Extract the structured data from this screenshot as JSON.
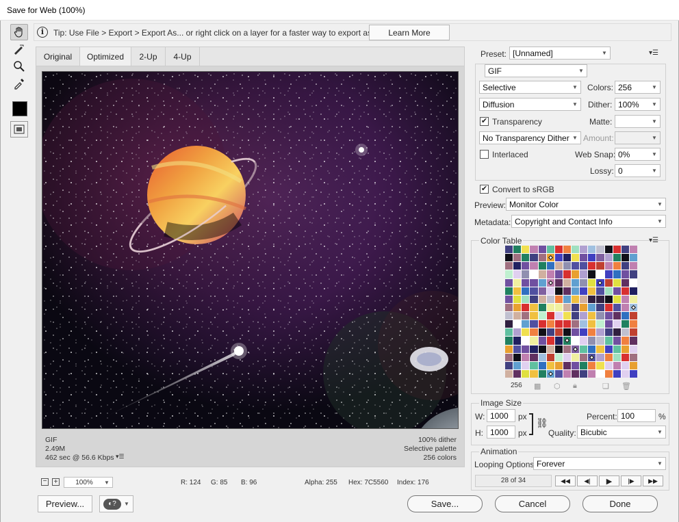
{
  "window": {
    "title": "Save for Web (100%)"
  },
  "tools": [
    {
      "name": "hand-tool",
      "icon": "hand-icon"
    },
    {
      "name": "slice-select-tool",
      "icon": "slice-select-icon"
    },
    {
      "name": "zoom-tool",
      "icon": "zoom-icon"
    },
    {
      "name": "eyedropper-tool",
      "icon": "eyedropper-icon"
    }
  ],
  "tip": {
    "text": "Tip: Use File > Export > Export As...  or right click on a layer for a faster way to export assets",
    "learn_more": "Learn More"
  },
  "tabs": [
    "Original",
    "Optimized",
    "2-Up",
    "4-Up"
  ],
  "selected_tab": "Optimized",
  "image_info": {
    "format": "GIF",
    "size": "2.49M",
    "download_time": "462 sec @ 56.6 Kbps",
    "dither": "100% dither",
    "palette": "Selective palette",
    "colors": "256 colors"
  },
  "status": {
    "zoom": "100%",
    "r": "R: 124",
    "g": "G: 85",
    "b": "B: 96",
    "alpha": "Alpha: 255",
    "hex": "Hex: 7C5560",
    "index": "Index: 176"
  },
  "preset": {
    "label": "Preset:",
    "value": "[Unnamed]"
  },
  "settings": {
    "format": "GIF",
    "reduction": "Selective",
    "colors_label": "Colors:",
    "colors": "256",
    "dither_algo": "Diffusion",
    "dither_label": "Dither:",
    "dither": "100%",
    "transparency_label": "Transparency",
    "transparency": true,
    "matte_label": "Matte:",
    "matte": "",
    "transparency_dither": "No Transparency Dither",
    "amount_label": "Amount:",
    "amount": "",
    "interlaced_label": "Interlaced",
    "interlaced": false,
    "websnap_label": "Web Snap:",
    "websnap": "0%",
    "lossy_label": "Lossy:",
    "lossy": "0",
    "srgb_label": "Convert to sRGB",
    "srgb": true,
    "preview_label": "Preview:",
    "preview": "Monitor Color",
    "metadata_label": "Metadata:",
    "metadata": "Copyright and Contact Info"
  },
  "color_table": {
    "title": "Color Table",
    "count": "256"
  },
  "image_size": {
    "title": "Image Size",
    "w_label": "W:",
    "w": "1000",
    "h_label": "H:",
    "h": "1000",
    "unit": "px",
    "percent_label": "Percent:",
    "percent": "100",
    "percent_unit": "%",
    "quality_label": "Quality:",
    "quality": "Bicubic"
  },
  "animation": {
    "title": "Animation",
    "looping_label": "Looping Options:",
    "looping": "Forever",
    "frame": "28 of 34"
  },
  "buttons": {
    "preview": "Preview...",
    "save": "Save...",
    "cancel": "Cancel",
    "done": "Done"
  }
}
